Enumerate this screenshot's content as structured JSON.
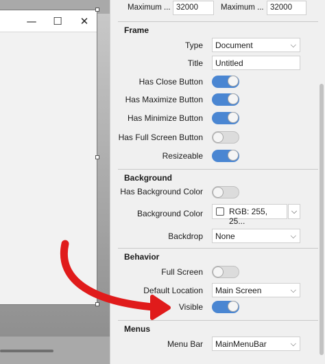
{
  "colors": {
    "toggle_on": "#4a86d2",
    "arrow": "#e01b1b"
  },
  "preview_window": {
    "minimize_icon": "minimize-icon",
    "maximize_icon": "maximize-icon",
    "close_icon": "close-icon",
    "minimize_glyph": "—",
    "maximize_glyph": "☐",
    "close_glyph": "✕"
  },
  "top": {
    "max_width_label": "Maximum ...",
    "max_width_value": "32000",
    "max_height_label": "Maximum ...",
    "max_height_value": "32000"
  },
  "frame": {
    "title": "Frame",
    "type_label": "Type",
    "type_value": "Document",
    "title_label": "Title",
    "title_value": "Untitled",
    "has_close_label": "Has Close Button",
    "has_close": true,
    "has_maximize_label": "Has Maximize Button",
    "has_maximize": true,
    "has_minimize_label": "Has Minimize Button",
    "has_minimize": true,
    "has_fullscreen_label": "Has Full Screen Button",
    "has_fullscreen": false,
    "resizeable_label": "Resizeable",
    "resizeable": true
  },
  "background": {
    "title": "Background",
    "has_bg_color_label": "Has Background Color",
    "has_bg_color": false,
    "bg_color_label": "Background Color",
    "bg_color_value": "RGB: 255, 25...",
    "backdrop_label": "Backdrop",
    "backdrop_value": "None"
  },
  "behavior": {
    "title": "Behavior",
    "full_screen_label": "Full Screen",
    "full_screen": false,
    "default_location_label": "Default Location",
    "default_location_value": "Main Screen",
    "visible_label": "Visible",
    "visible": true
  },
  "menus": {
    "title": "Menus",
    "menu_bar_label": "Menu Bar",
    "menu_bar_value": "MainMenuBar"
  },
  "glyphs": {
    "chevron": "⌵"
  }
}
